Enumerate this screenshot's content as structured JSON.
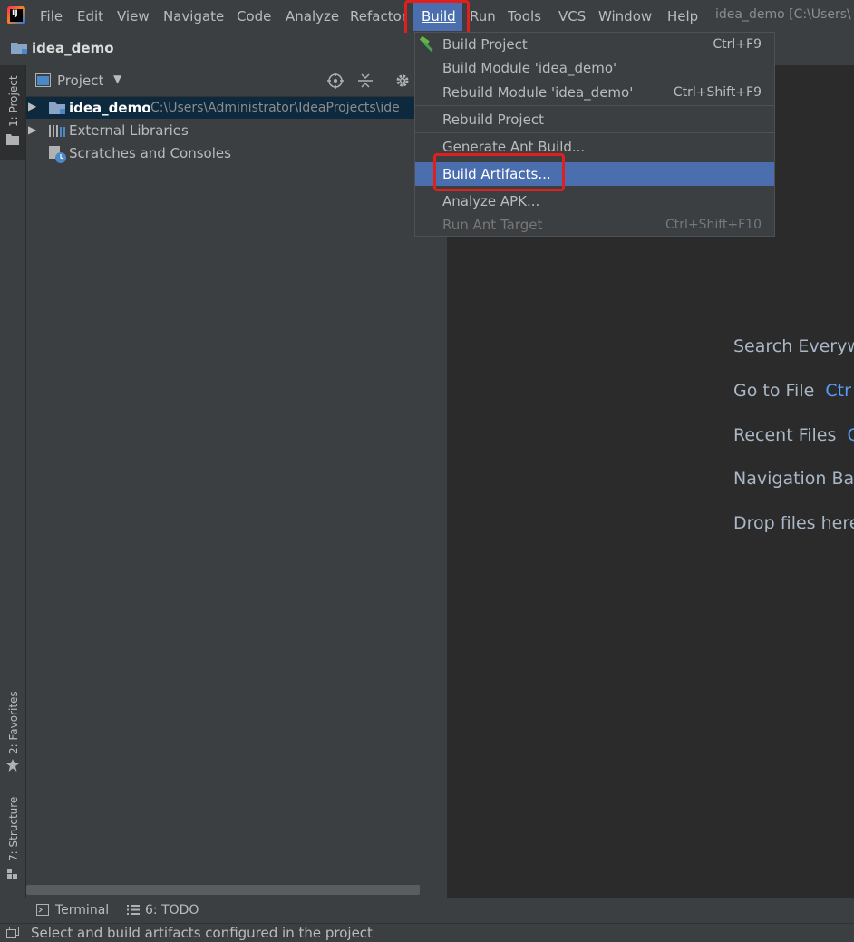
{
  "menubar": {
    "logo_text": "IJ",
    "items": [
      {
        "label": "File"
      },
      {
        "label": "Edit"
      },
      {
        "label": "View"
      },
      {
        "label": "Navigate"
      },
      {
        "label": "Code"
      },
      {
        "label": "Analyze"
      },
      {
        "label": "Refactor"
      },
      {
        "label": "Build"
      },
      {
        "label": "Run"
      },
      {
        "label": "Tools"
      },
      {
        "label": "VCS"
      },
      {
        "label": "Window"
      },
      {
        "label": "Help"
      }
    ],
    "window_title": "idea_demo [C:\\Users\\"
  },
  "navbar": {
    "project": "idea_demo"
  },
  "left_strip": {
    "project_tab": "1: Project",
    "favorites_tab": "2: Favorites",
    "structure_tab": "7: Structure"
  },
  "project_panel": {
    "title": "Project",
    "tree": [
      {
        "name": "idea_demo",
        "path": "C:\\Users\\Administrator\\IdeaProjects\\ide"
      },
      {
        "name": "External Libraries"
      },
      {
        "name": "Scratches and Consoles"
      }
    ]
  },
  "build_menu": {
    "items": [
      {
        "label": "Build Project",
        "shortcut": "Ctrl+F9"
      },
      {
        "label": "Build Module 'idea_demo'",
        "shortcut": ""
      },
      {
        "label": "Rebuild Module 'idea_demo'",
        "shortcut": "Ctrl+Shift+F9"
      },
      {
        "label": "Rebuild Project",
        "shortcut": ""
      },
      {
        "label": "Generate Ant Build...",
        "shortcut": ""
      },
      {
        "label": "Build Artifacts...",
        "shortcut": ""
      },
      {
        "label": "Analyze APK...",
        "shortcut": ""
      },
      {
        "label": "Run Ant Target",
        "shortcut": "Ctrl+Shift+F10"
      }
    ],
    "selected_index": 5
  },
  "editor_hints": [
    {
      "text": "Search Everyw",
      "key": ""
    },
    {
      "text": "Go to File",
      "key": "Ctr"
    },
    {
      "text": "Recent Files",
      "key": "C"
    },
    {
      "text": "Navigation Ba",
      "key": ""
    },
    {
      "text": "Drop files here",
      "key": ""
    }
  ],
  "bottom_bar": {
    "terminal": "Terminal",
    "todo": "6: TODO"
  },
  "status_bar": {
    "message": "Select and build artifacts configured in the project"
  },
  "colors": {
    "accent": "#4b6eaf",
    "highlight_box": "#e0201e",
    "editor_bg": "#2b2b2b",
    "panel_bg": "#3c3f41"
  }
}
